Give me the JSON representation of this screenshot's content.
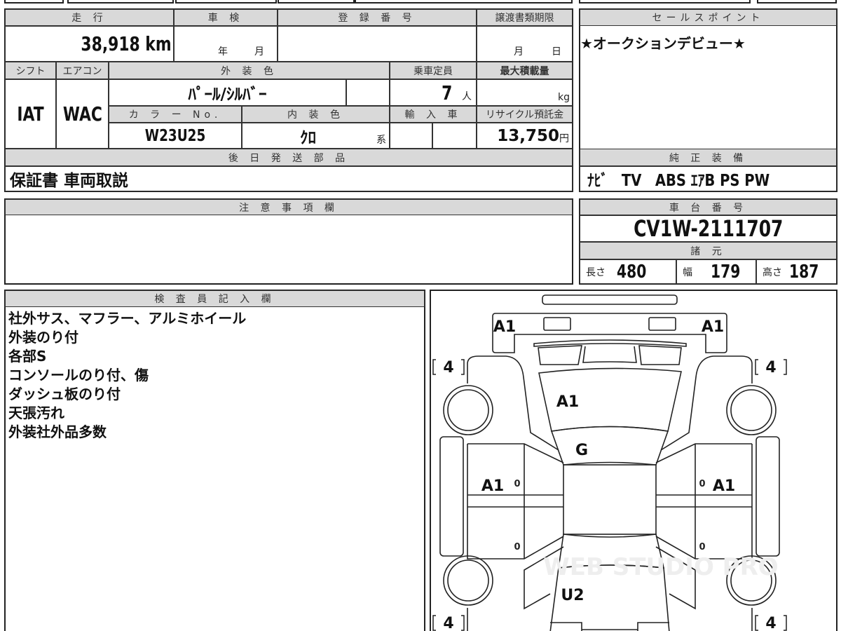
{
  "left_table": {
    "mileage_label": "走 行",
    "mileage_value": "38,918 km",
    "inspection_label": "車 検",
    "inspection_year_unit": "年",
    "inspection_month_unit": "月",
    "registration_label": "登 録 番 号",
    "transfer_deadline_label": "譲渡書類期限",
    "transfer_month_unit": "月",
    "transfer_day_unit": "日",
    "shift_label": "シフト",
    "shift_value": "IAT",
    "aircon_label": "エアコン",
    "aircon_value": "WAC",
    "exterior_color_label": "外 装 色",
    "exterior_color_value": "ﾊﾟｰﾙ/ｼﾙﾊﾞｰ",
    "capacity_label": "乗車定員",
    "capacity_value": "7",
    "capacity_unit": "人",
    "max_load_label": "最大積載量",
    "max_load_unit": "kg",
    "color_no_label": "カ ラ ー No.",
    "color_no_value": "W23U25",
    "interior_color_label": "内 装 色",
    "interior_color_value": "ｸﾛ",
    "interior_color_suffix": "系",
    "import_label": "輸 入 車",
    "recycle_label": "リサイクル預託金",
    "recycle_value": "13,750",
    "recycle_unit": "円",
    "later_parts_label": "後 日 発 送 部 品",
    "later_parts_value": "保証書 車両取説"
  },
  "sales_point": {
    "label": "セールスポイント",
    "value": "★オークションデビュー★"
  },
  "equipment": {
    "label": "純 正 装 備",
    "value": "ﾅﾋﾞ　TV　ABS ｴｱB PS PW"
  },
  "notes_box": {
    "label": "注 意 事 項 欄"
  },
  "chassis": {
    "label": "車 台 番 号",
    "value": "CV1W-2111707",
    "specs_label": "諸 元",
    "length_label": "長さ",
    "length_value": "480",
    "width_label": "幅",
    "width_value": "179",
    "height_label": "高さ",
    "height_value": "187"
  },
  "inspector": {
    "label": "検 査 員 記 入 欄",
    "lines": [
      "社外サス、マフラー、アルミホイール",
      "外装のり付",
      "各部S",
      "コンソールのり付、傷",
      "ダッシュ板のり付",
      "天張汚れ",
      "外装社外品多数"
    ]
  },
  "diagram": {
    "front_left_corner": "A1",
    "front_right_corner": "A1",
    "hood": "A1",
    "windshield": "G",
    "left_front_door": "A1",
    "right_front_door": "A1",
    "trunk": "U2",
    "tire_fl": "4",
    "tire_fr": "4",
    "tire_rl": "4",
    "tire_rr": "4",
    "door_mark": "0",
    "watermark": "WEB STUDIO PRO"
  }
}
